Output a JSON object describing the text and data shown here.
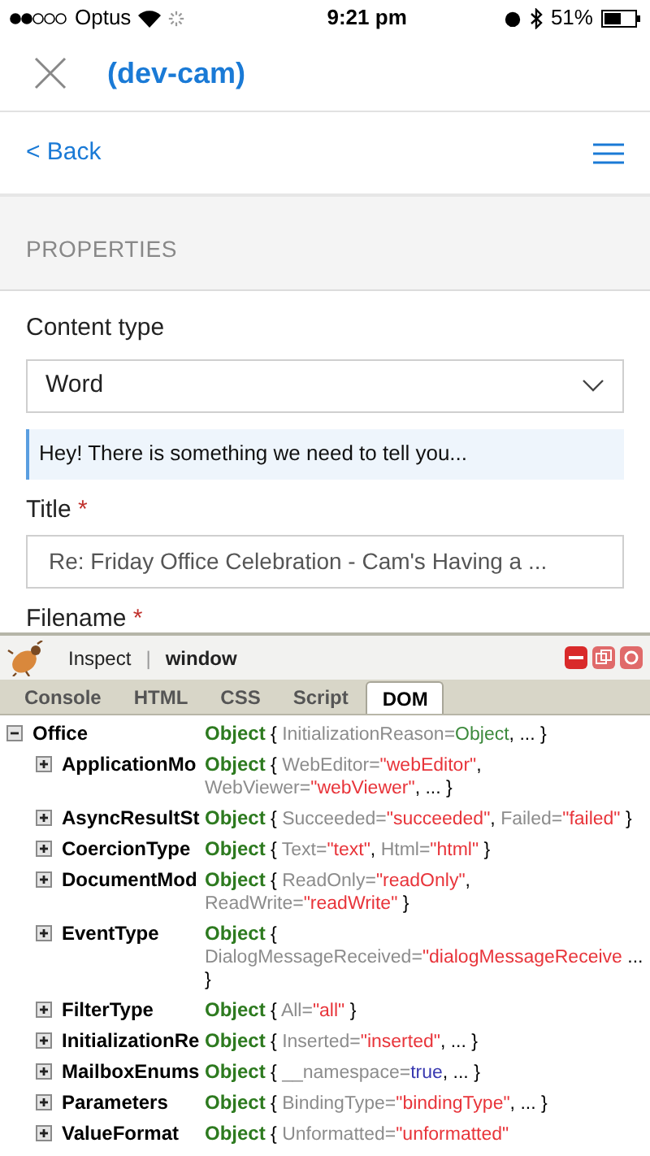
{
  "status_bar": {
    "carrier": "Optus",
    "time": "9:21 pm",
    "battery": "51%"
  },
  "header": {
    "title": "(dev-cam)"
  },
  "nav": {
    "back": "< Back"
  },
  "section": {
    "title": "PROPERTIES"
  },
  "form": {
    "content_type": {
      "label": "Content type",
      "value": "Word"
    },
    "message": "Hey! There is something we need to tell you...",
    "title": {
      "label": "Title",
      "required": "*",
      "value": "Re: Friday Office Celebration - Cam's Having a ..."
    },
    "filename": {
      "label": "Filename",
      "required": "*"
    }
  },
  "firebug": {
    "inspect": "Inspect",
    "separator": "|",
    "context": "window",
    "tabs": [
      {
        "label": "Console",
        "selected": false
      },
      {
        "label": "HTML",
        "selected": false
      },
      {
        "label": "CSS",
        "selected": false
      },
      {
        "label": "Script",
        "selected": false
      },
      {
        "label": "DOM",
        "selected": true
      }
    ],
    "tree": [
      {
        "name": "Office",
        "expanded": true,
        "type": "Object",
        "open": "{",
        "pairs": [
          {
            "key": "InitializationReason=",
            "value": "Object",
            "kind": "object",
            "comma": ","
          }
        ],
        "more": "...",
        "close": "}",
        "children": [
          {
            "name": "ApplicationMo",
            "expanded": false,
            "type": "Object",
            "open": "{",
            "pairs": [
              {
                "key": "WebEditor=",
                "value": "\"webEditor\"",
                "kind": "string",
                "comma": ","
              },
              {
                "key": "WebViewer=",
                "value": "\"webViewer\"",
                "kind": "string",
                "comma": ","
              }
            ],
            "more": "...",
            "close": "}"
          },
          {
            "name": "AsyncResultSt",
            "expanded": false,
            "type": "Object",
            "open": "{",
            "pairs": [
              {
                "key": "Succeeded=",
                "value": "\"succeeded\"",
                "kind": "string",
                "comma": ","
              },
              {
                "key": "Failed=",
                "value": "\"failed\"",
                "kind": "string"
              }
            ],
            "close": "}"
          },
          {
            "name": "CoercionType",
            "expanded": false,
            "type": "Object",
            "open": "{",
            "pairs": [
              {
                "key": "Text=",
                "value": "\"text\"",
                "kind": "string",
                "comma": ","
              },
              {
                "key": "Html=",
                "value": "\"html\"",
                "kind": "string"
              }
            ],
            "close": "}"
          },
          {
            "name": "DocumentMod",
            "expanded": false,
            "type": "Object",
            "open": "{",
            "pairs": [
              {
                "key": "ReadOnly=",
                "value": "\"readOnly\"",
                "kind": "string",
                "comma": ","
              },
              {
                "key": "ReadWrite=",
                "value": "\"readWrite\"",
                "kind": "string"
              }
            ],
            "close": "}"
          },
          {
            "name": "EventType",
            "expanded": false,
            "type": "Object",
            "open": "{",
            "pairs": [
              {
                "key": "DialogMessageReceived=",
                "value": "\"dialogMessageReceive",
                "kind": "string"
              }
            ],
            "more": "...",
            "close": "}"
          },
          {
            "name": "FilterType",
            "expanded": false,
            "type": "Object",
            "open": "{",
            "pairs": [
              {
                "key": "All=",
                "value": "\"all\"",
                "kind": "string"
              }
            ],
            "close": "}"
          },
          {
            "name": "InitializationRe",
            "expanded": false,
            "type": "Object",
            "open": "{",
            "pairs": [
              {
                "key": "Inserted=",
                "value": "\"inserted\"",
                "kind": "string",
                "comma": ","
              }
            ],
            "more": "...",
            "close": "}"
          },
          {
            "name": "MailboxEnums",
            "expanded": false,
            "type": "Object",
            "open": "{",
            "pairs": [
              {
                "key": "__namespace=",
                "value": "true",
                "kind": "bool",
                "comma": ","
              }
            ],
            "more": "...",
            "close": "}"
          },
          {
            "name": "Parameters",
            "expanded": false,
            "type": "Object",
            "open": "{",
            "pairs": [
              {
                "key": "BindingType=",
                "value": "\"bindingType\"",
                "kind": "string",
                "comma": ","
              }
            ],
            "more": "...",
            "close": "}"
          },
          {
            "name": "ValueFormat",
            "expanded": false,
            "type": "Object",
            "open": "{",
            "pairs": [
              {
                "key": "Unformatted=",
                "value": "\"unformatted\"",
                "kind": "string"
              }
            ]
          }
        ]
      }
    ]
  }
}
